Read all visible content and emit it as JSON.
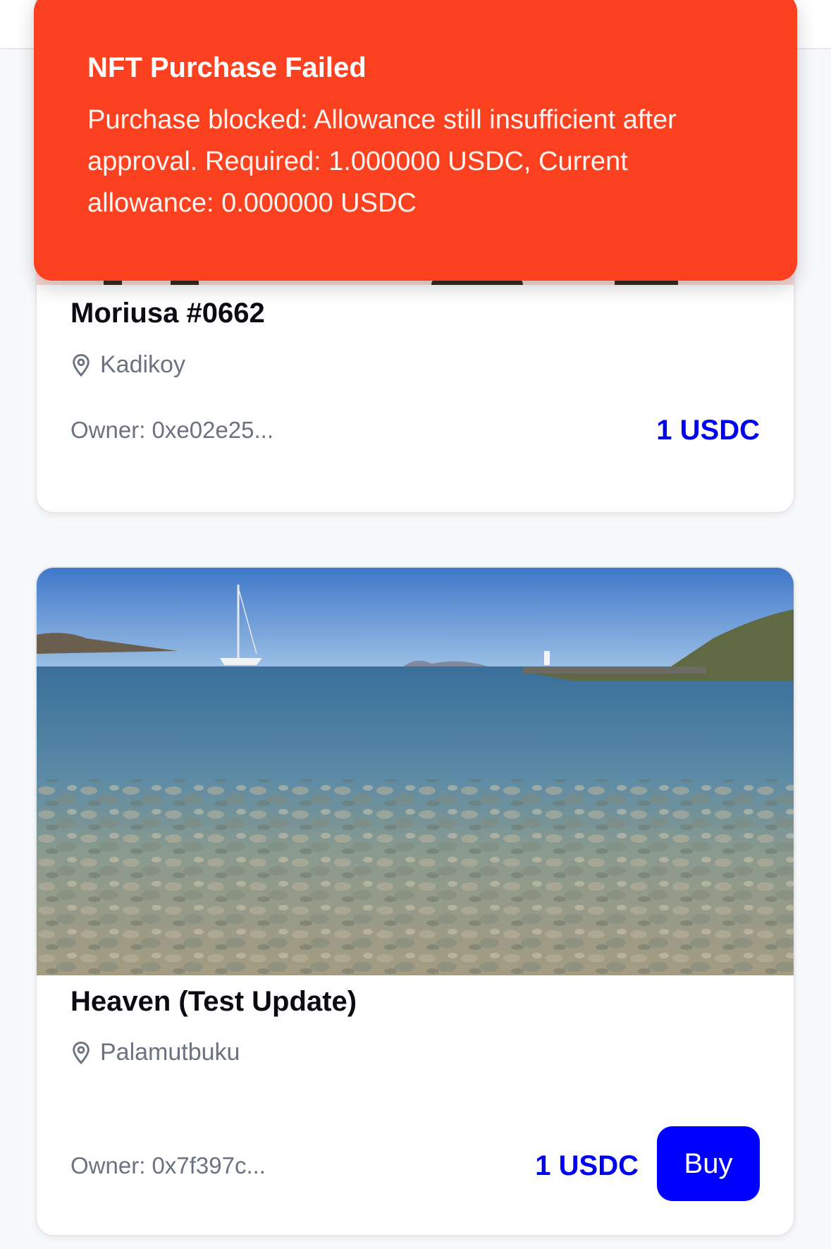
{
  "toast": {
    "title": "NFT Purchase Failed",
    "message": "Purchase blocked: Allowance still insufficient after approval. Required: 1.000000 USDC, Current allowance: 0.000000 USDC",
    "color": "#fc4120"
  },
  "listings": [
    {
      "title": "Moriusa #0662",
      "location": "Kadikoy",
      "owner": "Owner: 0xe02e25...",
      "price": "1 USDC"
    },
    {
      "title": "Heaven (Test Update)",
      "location": "Palamutbuku",
      "owner": "Owner: 0x7f397c...",
      "price": "1 USDC",
      "buy_label": "Buy"
    }
  ],
  "colors": {
    "accent": "#0000ff",
    "muted_text": "#6b7280"
  },
  "icons": {
    "location": "map-pin-icon"
  }
}
